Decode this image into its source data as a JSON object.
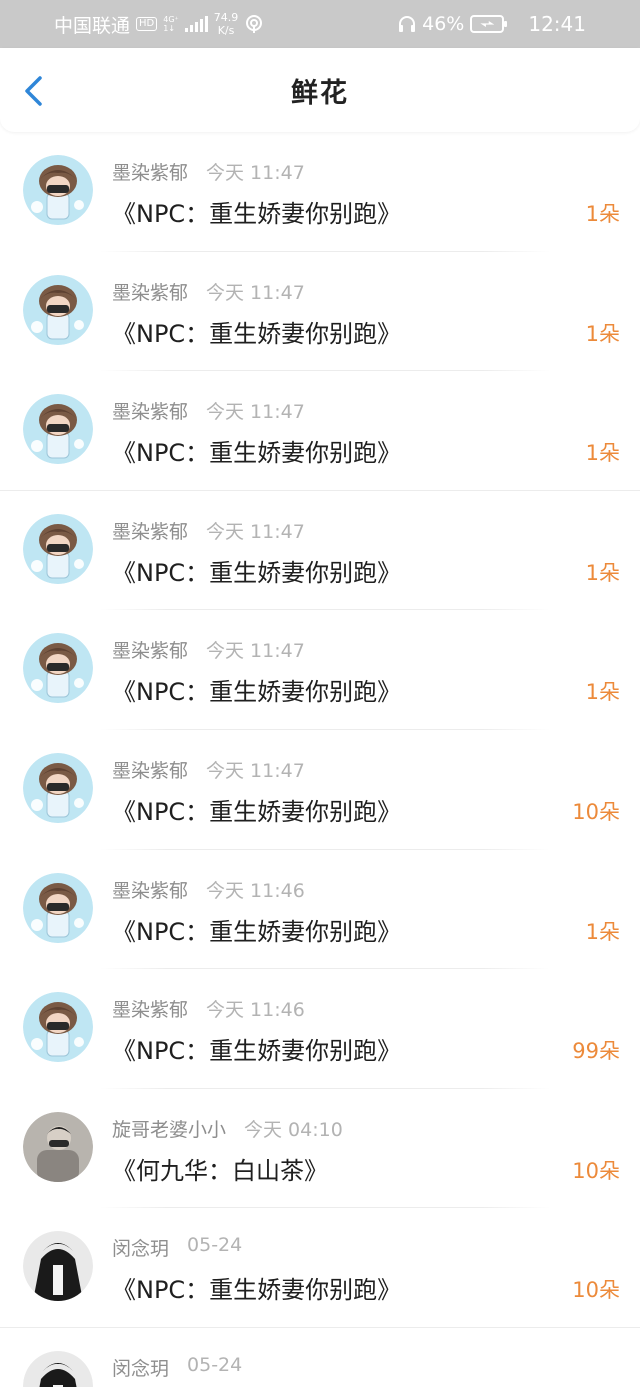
{
  "status_bar": {
    "carrier": "中国联通",
    "hd": "HD",
    "network_top": "4G⁺",
    "network_bottom": "1↓",
    "speed_value": "74.9",
    "speed_unit": "K/s",
    "battery_percent": "46%",
    "time": "12:41"
  },
  "header": {
    "title": "鲜花",
    "back_icon": "chevron-left-icon"
  },
  "colors": {
    "accent": "#2f86d8",
    "amount": "#ec8a3a",
    "status_bar_bg": "#c9c9c9"
  },
  "items": [
    {
      "user": "墨染紫郁",
      "time": "今天 11:47",
      "book": "《NPC：重生娇妻你别跑》",
      "amount": "1朵",
      "avatar": "cartoon"
    },
    {
      "user": "墨染紫郁",
      "time": "今天 11:47",
      "book": "《NPC：重生娇妻你别跑》",
      "amount": "1朵",
      "avatar": "cartoon"
    },
    {
      "user": "墨染紫郁",
      "time": "今天 11:47",
      "book": "《NPC：重生娇妻你别跑》",
      "amount": "1朵",
      "avatar": "cartoon"
    },
    {
      "user": "墨染紫郁",
      "time": "今天 11:47",
      "book": "《NPC：重生娇妻你别跑》",
      "amount": "1朵",
      "avatar": "cartoon"
    },
    {
      "user": "墨染紫郁",
      "time": "今天 11:47",
      "book": "《NPC：重生娇妻你别跑》",
      "amount": "1朵",
      "avatar": "cartoon"
    },
    {
      "user": "墨染紫郁",
      "time": "今天 11:47",
      "book": "《NPC：重生娇妻你别跑》",
      "amount": "10朵",
      "avatar": "cartoon"
    },
    {
      "user": "墨染紫郁",
      "time": "今天 11:46",
      "book": "《NPC：重生娇妻你别跑》",
      "amount": "1朵",
      "avatar": "cartoon"
    },
    {
      "user": "墨染紫郁",
      "time": "今天 11:46",
      "book": "《NPC：重生娇妻你别跑》",
      "amount": "99朵",
      "avatar": "cartoon"
    },
    {
      "user": "旋哥老婆小小",
      "time": "今天 04:10",
      "book": "《何九华：白山茶》",
      "amount": "10朵",
      "avatar": "photo-gray"
    },
    {
      "user": "闵念玥",
      "time": "05-24",
      "book": "《NPC：重生娇妻你别跑》",
      "amount": "10朵",
      "avatar": "photo-dark"
    },
    {
      "user": "闵念玥",
      "time": "05-24",
      "book": "",
      "amount": "",
      "avatar": "photo-dark"
    }
  ]
}
